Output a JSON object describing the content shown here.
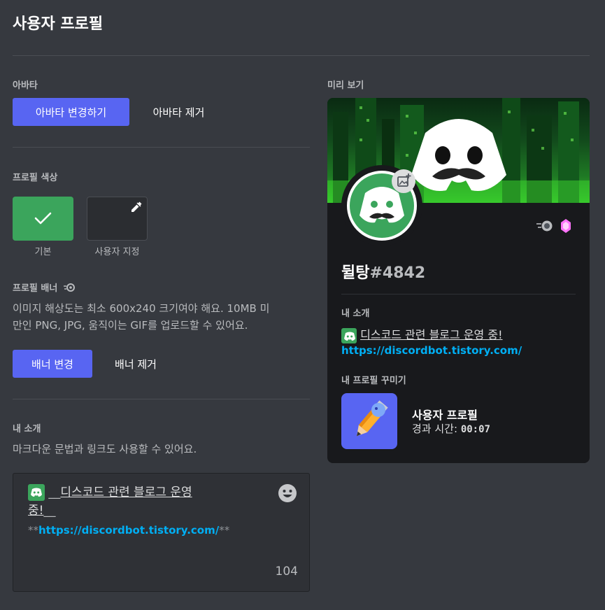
{
  "page": {
    "title": "사용자 프로필"
  },
  "avatar": {
    "label": "아바타",
    "change_button": "아바타 변경하기",
    "remove_button": "아바타 제거"
  },
  "profile_color": {
    "label": "프로필 색상",
    "default_caption": "기본",
    "custom_caption": "사용자 지정",
    "default_color": "#3ba55c",
    "custom_color": "#2b2d31"
  },
  "banner": {
    "label": "프로필 배너",
    "description_line1": "이미지 해상도는 최소 600x240 크기여야 해요. 10MB 미",
    "description_line2": "만인 PNG, JPG, 움직이는 GIF를 업로드할 수 있어요.",
    "change_button": "배너 변경",
    "remove_button": "배너 제거"
  },
  "about": {
    "label": "내 소개",
    "hint": "마크다운 문법과 링크도 사용할 수 있어요.",
    "line1_prefix": "__",
    "line1_text": "디스코드 관련 블로그 운영",
    "line2_text": "중!",
    "line2_suffix": "__",
    "link_prefix": "**",
    "link_text": "https://discordbot.tistory.com/",
    "link_suffix": "**",
    "char_count": "104"
  },
  "preview": {
    "label": "미리 보기",
    "username": "뒬탕",
    "discriminator": "#4842",
    "about_label": "내 소개",
    "about_text": "디스코드 관련 블로그 운영 중!",
    "about_link": "https://discordbot.tistory.com/",
    "decor_label": "내 프로필 꾸미기",
    "activity_title": "사용자 프로필",
    "elapsed_label": "경과 시간:",
    "elapsed_value": "00:07"
  },
  "colors": {
    "brand": "#5865f2",
    "green": "#3ba55c",
    "link": "#00aff4"
  },
  "icons": {
    "checkmark": "check-icon",
    "eyedropper": "eyedropper-icon",
    "nitro": "nitro-icon",
    "boost": "boost-gem-icon",
    "emoji_picker": "smile-emoji-icon",
    "add_image": "add-image-icon"
  }
}
